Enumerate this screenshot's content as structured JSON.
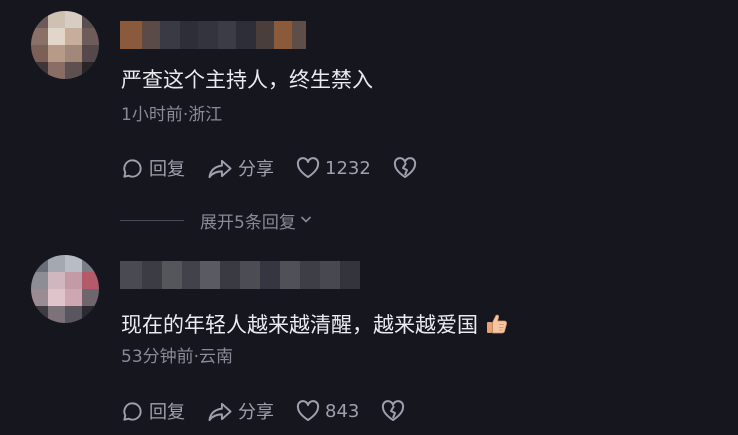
{
  "comments": [
    {
      "text": "严查这个主持人，终生禁入",
      "time_location": "1小时前·浙江",
      "reply_label": "回复",
      "share_label": "分享",
      "like_count": "1232",
      "avatar_icon": "blurred-avatar",
      "emoji_icon": null
    },
    {
      "text": "现在的年轻人越来越清醒，越来越爱国",
      "time_location": "53分钟前·云南",
      "reply_label": "回复",
      "share_label": "分享",
      "like_count": "843",
      "avatar_icon": "blurred-avatar",
      "emoji_icon": "thumbs-up-emoji"
    }
  ],
  "expand_replies_label": "展开5条回复",
  "colors": {
    "background": "#16161e",
    "text_primary": "#eaeaf0",
    "text_secondary": "#8a8a96",
    "icon": "#a0a0aa"
  }
}
